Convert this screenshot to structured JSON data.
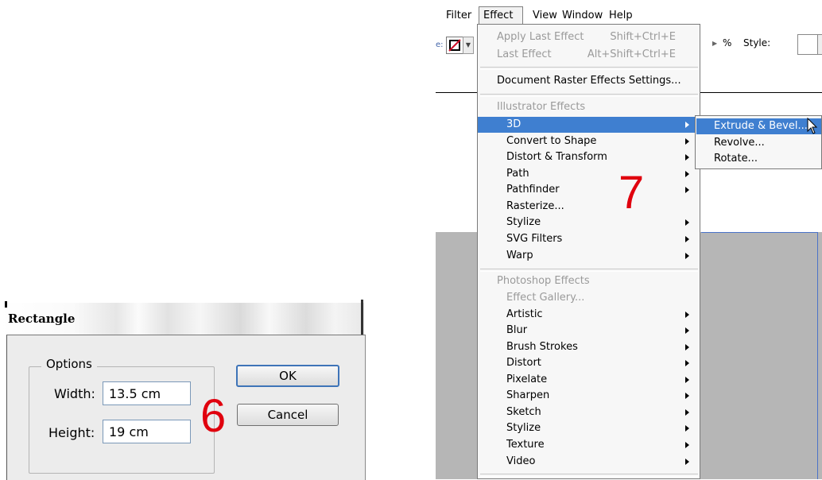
{
  "rectangle_dialog": {
    "title": "Rectangle",
    "group_label": "Options",
    "width_label": "Width:",
    "width_value": "13.5 cm",
    "height_label": "Height:",
    "height_value": "19 cm",
    "ok_label": "OK",
    "cancel_label": "Cancel",
    "step_number": "6"
  },
  "menubar": {
    "items": [
      "Filter",
      "Effect",
      "View",
      "Window",
      "Help"
    ]
  },
  "toolbar": {
    "percent_label": "%",
    "style_label": "Style:",
    "left_tick": "e:"
  },
  "effect_menu": {
    "apply_last": {
      "label": "Apply Last Effect",
      "shortcut": "Shift+Ctrl+E"
    },
    "last_effect": {
      "label": "Last Effect",
      "shortcut": "Alt+Shift+Ctrl+E"
    },
    "raster_settings": "Document Raster Effects Settings...",
    "illustrator_header": "Illustrator Effects",
    "illustrator_items": [
      "3D",
      "Convert to Shape",
      "Distort & Transform",
      "Path",
      "Pathfinder",
      "Rasterize...",
      "Stylize",
      "SVG Filters",
      "Warp"
    ],
    "photoshop_header": "Photoshop Effects",
    "photoshop_items": [
      "Effect Gallery...",
      "Artistic",
      "Blur",
      "Brush Strokes",
      "Distort",
      "Pixelate",
      "Sharpen",
      "Sketch",
      "Stylize",
      "Texture",
      "Video"
    ]
  },
  "submenu_3d": {
    "items": [
      "Extrude & Bevel...",
      "Revolve...",
      "Rotate..."
    ]
  },
  "step_7": "7",
  "colors": {
    "highlight": "#3f7fd0",
    "step_number": "#e0000e",
    "canvas": "#b6b6b6"
  }
}
